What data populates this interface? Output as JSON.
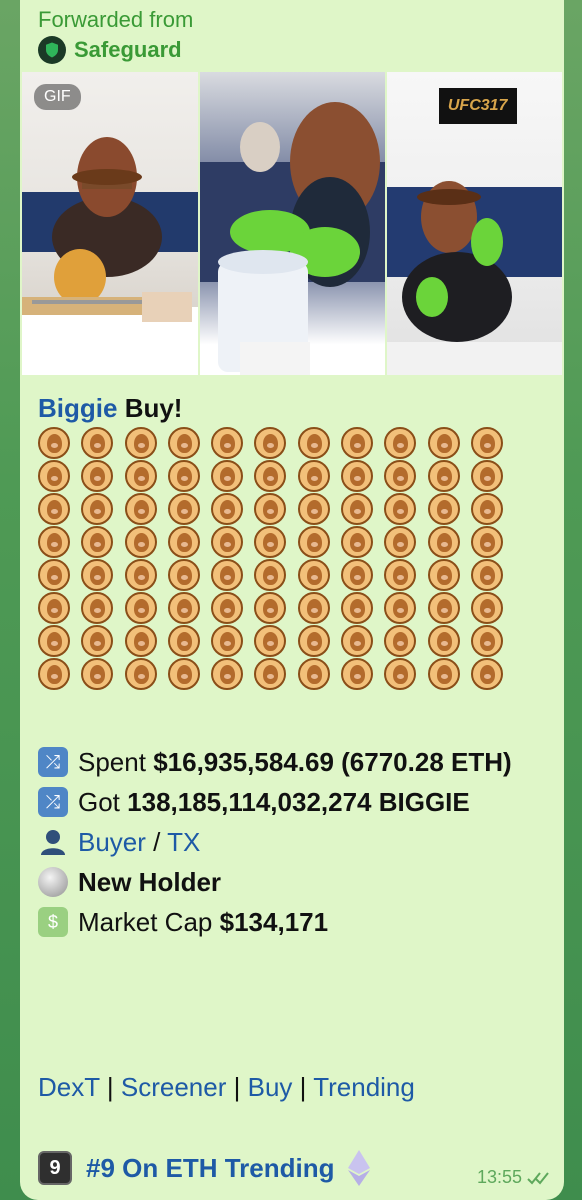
{
  "message": {
    "forwarded_label": "Forwarded from",
    "forwarded_source": "Safeguard",
    "media": {
      "badge": "GIF",
      "overlay_logo": "UFC317"
    },
    "title_token": "Biggie",
    "title_suffix": "Buy!",
    "emoji_grid": {
      "emoji": "bear-coin-icon",
      "columns": 11,
      "rows": 8
    },
    "spent": {
      "label": "Spent",
      "value": "$16,935,584.69 (6770.28 ETH)"
    },
    "got": {
      "label": "Got",
      "value": "138,185,114,032,274 BIGGIE"
    },
    "buyer_link": "Buyer",
    "separator": "/",
    "tx_link": "TX",
    "new_holder": "New Holder",
    "market_cap": {
      "label": "Market Cap",
      "value": "$134,171"
    },
    "links": [
      "DexT",
      "Screener",
      "Buy",
      "Trending"
    ],
    "trending": {
      "keycap": "9",
      "text": "#9 On ETH Trending"
    },
    "time": "13:55"
  }
}
